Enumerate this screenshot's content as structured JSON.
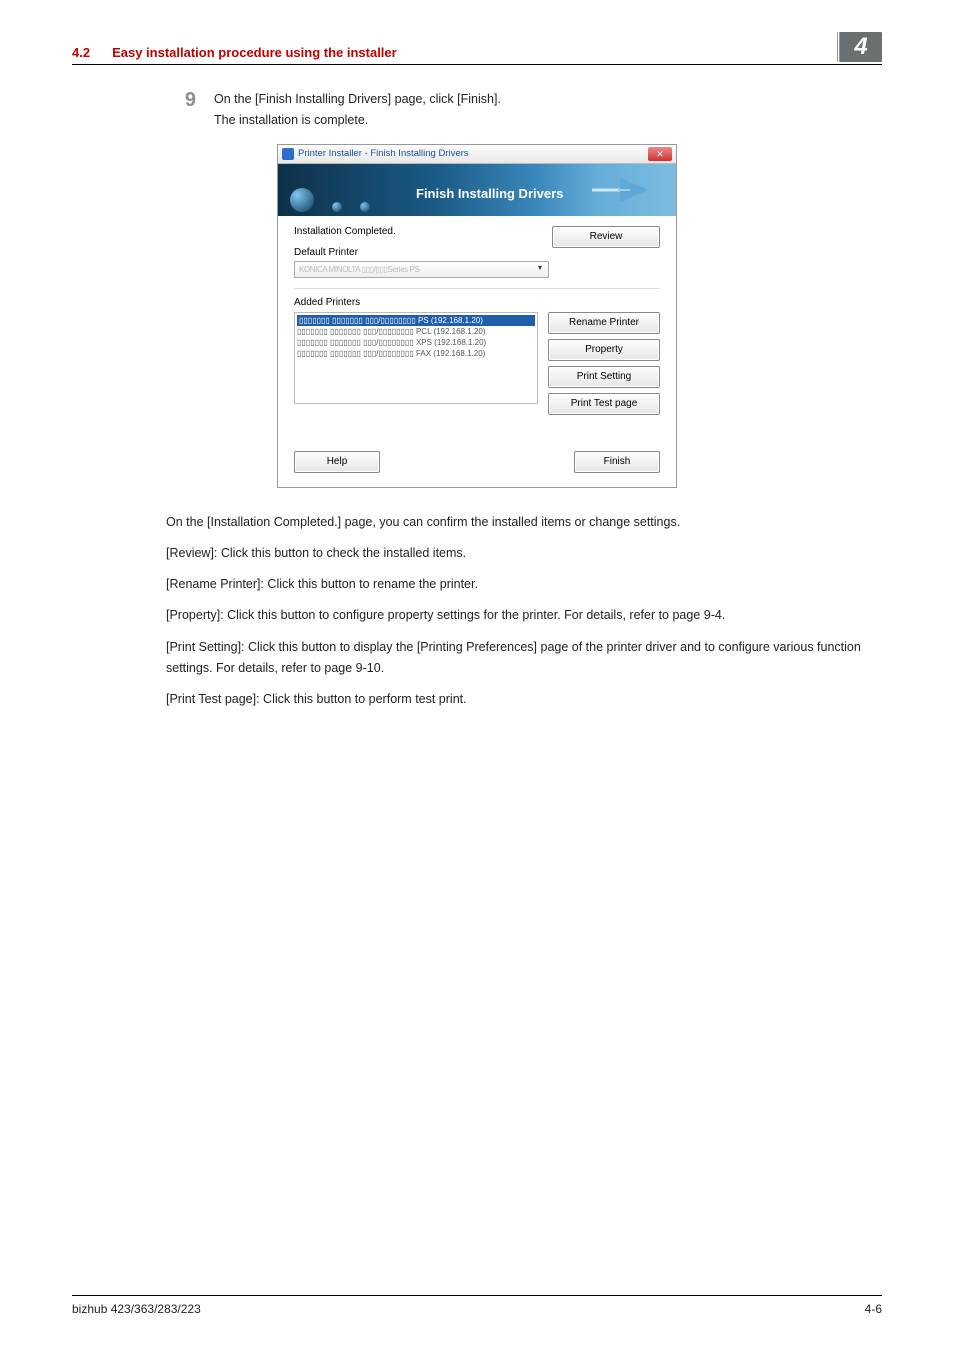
{
  "header": {
    "section": "4.2",
    "title": "Easy installation procedure using the installer",
    "chapter": "4"
  },
  "step": {
    "num": "9",
    "line1": "On the [Finish Installing Drivers] page, click [Finish].",
    "line2": "The installation is complete."
  },
  "screenshot": {
    "window_title": "Printer Installer - Finish Installing Drivers",
    "banner_text": "Finish Installing Drivers",
    "installed_label": "Installation Completed.",
    "review_btn": "Review",
    "default_printer_label": "Default Printer",
    "default_printer_value": "KONICA MINOLTA ▯▯▯/▯▯▯Series PS",
    "added_printers_label": "Added Printers",
    "list_row_selected": "▯▯▯▯▯▯▯ ▯▯▯▯▯▯▯ ▯▯▯/▯▯▯▯▯▯▯▯ PS (192.168.1.20)",
    "list_rows": [
      "▯▯▯▯▯▯▯ ▯▯▯▯▯▯▯ ▯▯▯/▯▯▯▯▯▯▯▯ PCL (192.168.1.20)",
      "▯▯▯▯▯▯▯ ▯▯▯▯▯▯▯ ▯▯▯/▯▯▯▯▯▯▯▯ XPS (192.168.1.20)",
      "▯▯▯▯▯▯▯ ▯▯▯▯▯▯▯ ▯▯▯/▯▯▯▯▯▯▯▯ FAX (192.168.1.20)"
    ],
    "rename_btn": "Rename Printer",
    "property_btn": "Property",
    "printsetting_btn": "Print Setting",
    "printtest_btn": "Print Test page",
    "help_btn": "Help",
    "finish_btn": "Finish"
  },
  "paragraphs": {
    "p1": "On the [Installation Completed.] page, you can confirm the installed items or change settings.",
    "p2": "[Review]: Click this button to check the installed items.",
    "p3": "[Rename Printer]: Click this button to rename the printer.",
    "p4": "[Property]: Click this button to configure property settings for the printer. For details, refer to page 9-4.",
    "p5": "[Print Setting]: Click this button to display the [Printing Preferences] page of the printer driver and to configure various function settings. For details, refer to page 9-10.",
    "p6": "[Print Test page]: Click this button to perform test print."
  },
  "footer": {
    "left": "bizhub 423/363/283/223",
    "right": "4-6"
  }
}
